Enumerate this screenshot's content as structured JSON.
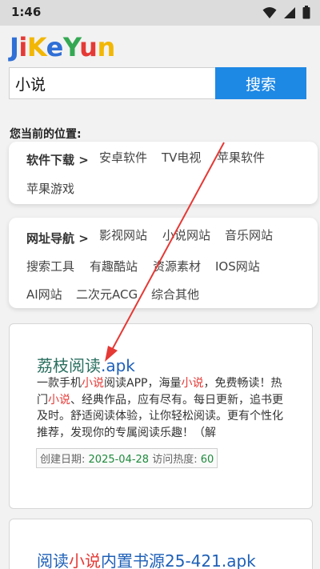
{
  "status": {
    "time": "1:46"
  },
  "logo": {
    "letters": [
      {
        "ch": "J",
        "color": "#2f6fd6"
      },
      {
        "ch": "i",
        "color": "#e53935"
      },
      {
        "ch": "K",
        "color": "#f2b705"
      },
      {
        "ch": "e",
        "color": "#2f6fd6"
      },
      {
        "ch": "Y",
        "color": "#34a853"
      },
      {
        "ch": "u",
        "color": "#e53935"
      },
      {
        "ch": "n",
        "color": "#f2b705"
      }
    ]
  },
  "search": {
    "value": "小说",
    "button": "搜索"
  },
  "location": "您当前的位置:",
  "software": {
    "label": "软件下载 >",
    "links": [
      "安卓软件",
      "TV电视",
      "苹果软件",
      "苹果游戏"
    ]
  },
  "nav": {
    "label": "网址导航 >",
    "links": [
      "影视网站",
      "小说网站",
      "音乐网站",
      "搜索工具",
      "有趣酷站",
      "资源素材",
      "IOS网站",
      "AI网站",
      "二次元ACG",
      "综合其他"
    ]
  },
  "results": [
    {
      "title_a": "荔枝阅读",
      "title_ext": ".apk",
      "desc_parts": [
        "一款手机",
        "小说",
        "阅读APP，海量",
        "小说",
        "，免费畅读！热门",
        "小说",
        "、经典作品，应有尽有。每日更新，追书更及时。舒适阅读体验，让你轻松阅读。更有个性化推荐，发现你的专属阅读乐趣！（解"
      ],
      "meta_date_label": "创建日期:",
      "meta_date": "2025-04-28",
      "meta_heat_label": "访问热度:",
      "meta_heat": "60"
    },
    {
      "title_a": "阅读",
      "title_hl": "小说",
      "title_b": "内置书源25-421.apk"
    }
  ],
  "colors": {
    "accent": "#1e88e5",
    "highlight": "#e53935",
    "arrow": "#e53935"
  }
}
